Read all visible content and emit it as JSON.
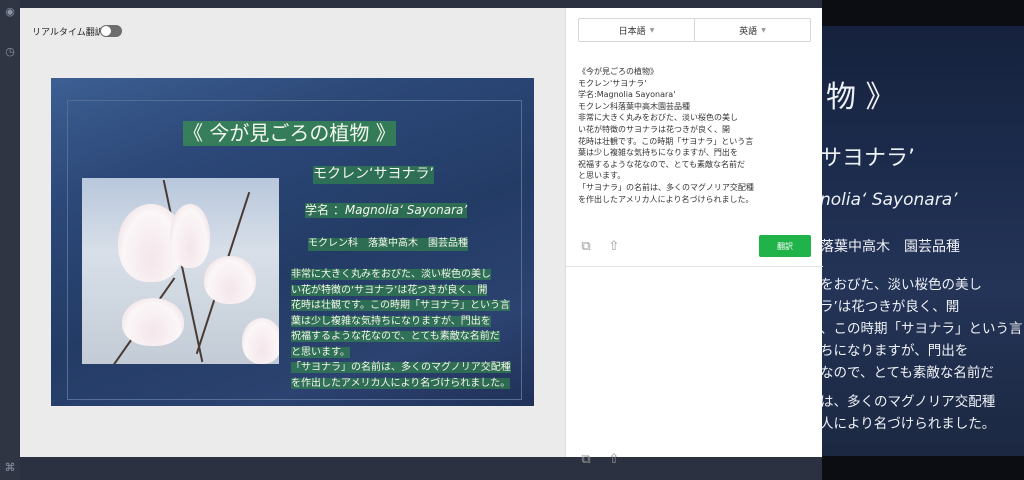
{
  "left_panel": {
    "realtime_label": "リアルタイム翻訳",
    "realtime_enabled": false
  },
  "image_overlay": {
    "title": "《 今が見ごろの植物 》",
    "plant_name": "モクレン‘サヨナラ’",
    "scientific_prefix": "学名 ：",
    "scientific_name": "Magnolia‘ Sayonara’",
    "family": "モクレン科　落葉中高木　園芸品種",
    "body_lines": [
      "非常に大きく丸みをおびた、淡い桜色の美し",
      "い花が特徴の‘サヨナラ’は花つきが良く、開",
      "花時は壮観です。この時期「サヨナラ」という言",
      "葉は少し複雑な気持ちになりますが、門出を",
      "祝福するような花なので、とても素敵な名前だ",
      "と思います。",
      "「サヨナラ」の名前は、多くのマグノリア交配種",
      "を作出したアメリカ人により名づけられました。"
    ]
  },
  "right_panel": {
    "source_language": "日本語",
    "target_language": "英語",
    "ocr_text": "《今が見ごろの植物》\nモクレン'サヨナラ'\n学名:Magnolia Sayonara'\nモクレン科落葉中高木園芸品種\n非常に大きく丸みをおびた、淡い桜色の美し\nい花が特徴のサヨナラは花つきが良く、開\n花時は壮観です。この時期「サヨナラ」という言\n葉は少し複雑な気持ちになりますが、門出を\n祝福するような花なので、とても素敵な名前だ\nと思います。\n「サヨナラ」の名前は、多くのマグノリア交配種\nを作出したアメリカ人により名づけられました。",
    "translate_button": "翻訳"
  },
  "background_photo": {
    "lines": [
      "物 》",
      "サヨナラ’",
      "nolia‘ Sayonara’",
      "落葉中高木　園芸品種",
      "をおびた、淡い桜色の美し",
      "ラ’は花つきが良く、開",
      "、この時期「サヨナラ」という言",
      "ちになりますが、門出を",
      "なので、とても素敵な名前だ",
      "は、多くのマグノリア交配種",
      "人により名づけられました。"
    ]
  },
  "icons": {
    "copy": "copy-icon",
    "share": "share-icon",
    "rail_user": "user-icon",
    "rail_clock": "clock-icon",
    "rail_crop": "crop-icon"
  },
  "colors": {
    "accent_green": "#1fb34a"
  }
}
